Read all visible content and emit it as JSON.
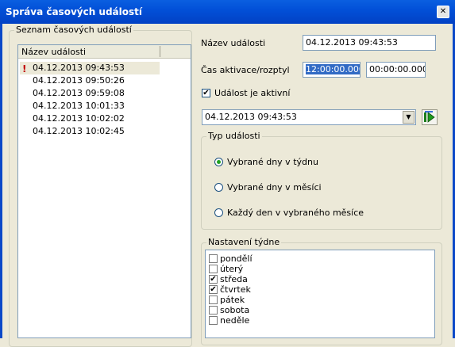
{
  "window": {
    "title": "Správa časových událostí",
    "close": "✕"
  },
  "left_group": {
    "legend": "Seznam časových událostí",
    "list_header": "Název události",
    "items": [
      {
        "label": "04.12.2013 09:43:53",
        "warning": "!"
      },
      {
        "label": "04.12.2013 09:50:26"
      },
      {
        "label": "04.12.2013 09:59:08"
      },
      {
        "label": "04.12.2013 10:01:33"
      },
      {
        "label": "04.12.2013 10:02:02"
      },
      {
        "label": "04.12.2013 10:02:45"
      }
    ]
  },
  "form": {
    "name_label": "Název události",
    "name_value": "04.12.2013 09:43:53",
    "activation_label": "Čas aktivace/rozptyl",
    "activation_time": "12:00:00.000",
    "activation_spread": "00:00:00.000",
    "active_label": "Událost je aktivní",
    "active_check": "✔",
    "event_combo_value": "04.12.2013 09:43:53",
    "combo_arrow": "▼"
  },
  "event_type": {
    "legend": "Typ události",
    "options": [
      {
        "label": "Vybrané dny v týdnu"
      },
      {
        "label": "Vybrané dny v měsíci"
      },
      {
        "label": "Každý den v vybraného měsíce"
      }
    ]
  },
  "week": {
    "legend": "Nastavení týdne",
    "days": [
      {
        "label": "pondělí",
        "check": ""
      },
      {
        "label": "úterý",
        "check": ""
      },
      {
        "label": "středa",
        "check": "✔"
      },
      {
        "label": "čtvrtek",
        "check": "✔"
      },
      {
        "label": "pátek",
        "check": ""
      },
      {
        "label": "sobota",
        "check": ""
      },
      {
        "label": "neděle",
        "check": ""
      }
    ]
  }
}
